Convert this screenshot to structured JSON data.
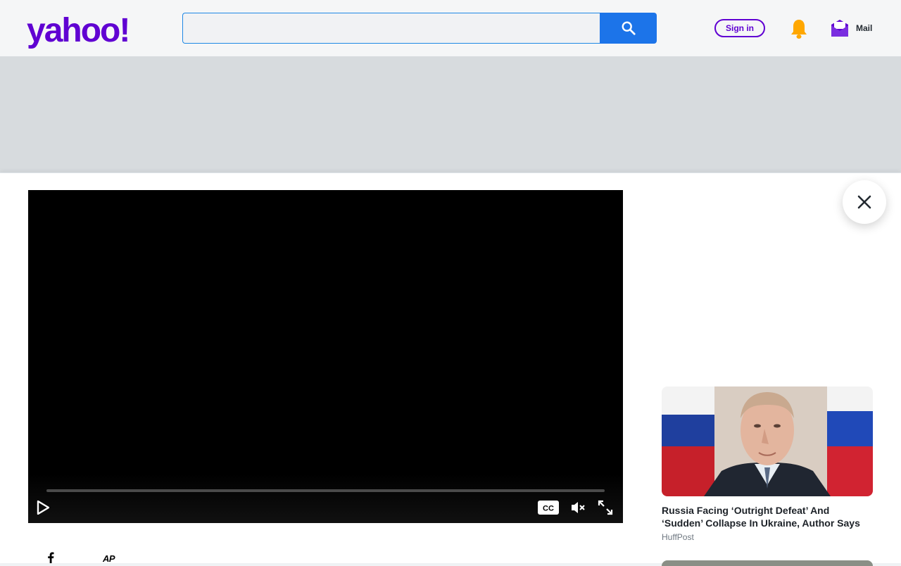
{
  "header": {
    "logo_text": "yahoo!",
    "search": {
      "value": "",
      "placeholder": ""
    },
    "signin_label": "Sign in",
    "mail_label": "Mail"
  },
  "colors": {
    "brand_purple": "#6001d2",
    "search_blue": "#1c74e9",
    "bell_orange": "#ffa700",
    "mail_purple": "#5f01d1"
  },
  "icons": {
    "search": "search-icon",
    "notifications": "bell-icon",
    "mail": "mail-envelope-icon",
    "close": "close-icon",
    "play": "play-icon",
    "captions": "closed-captions-icon",
    "mute": "muted-speaker-icon",
    "fullscreen": "fullscreen-expand-icon",
    "share": "facebook-icon"
  },
  "video": {
    "progress": 0,
    "cc_label": "CC",
    "source_logo": "AP"
  },
  "sidebar": {
    "stories": [
      {
        "title": "Russia Facing ‘Outright Defeat’ And ‘Sudden’ Collapse In Ukraine, Author Says",
        "source": "HuffPost"
      }
    ]
  }
}
